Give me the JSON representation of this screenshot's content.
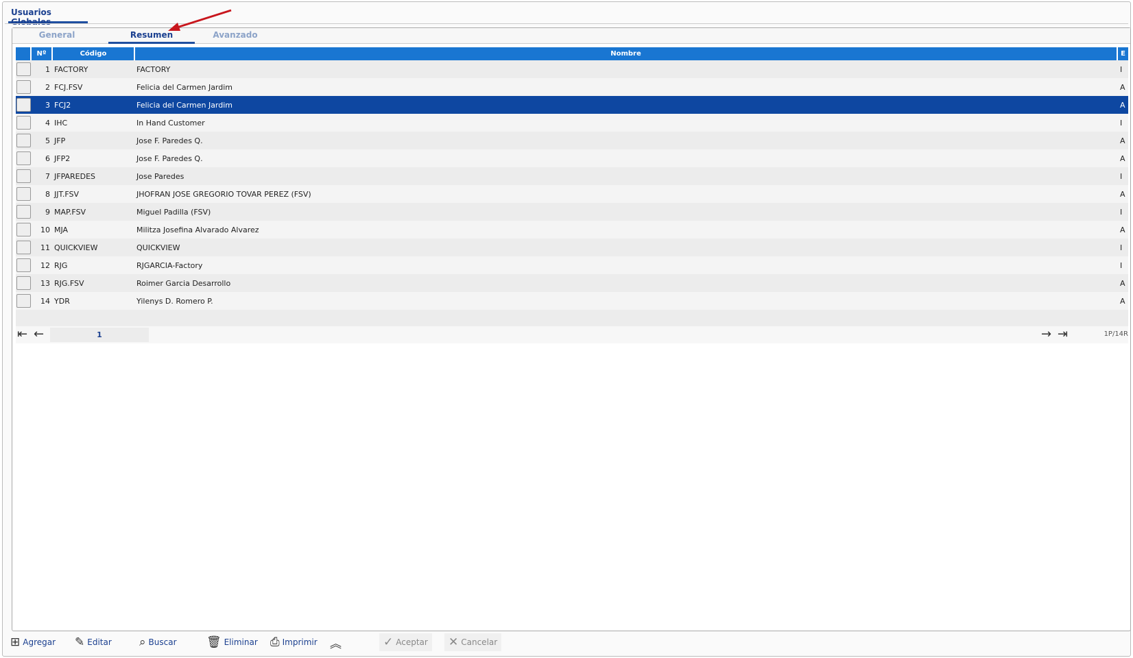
{
  "window_tab": "Usuarios Globales",
  "tabs": [
    {
      "label": "General"
    },
    {
      "label": "Resumen"
    },
    {
      "label": "Avanzado"
    }
  ],
  "columns": {
    "num": "Nº",
    "code": "Código",
    "name": "Nombre",
    "status": "E"
  },
  "rows": [
    {
      "n": "1",
      "code": "FACTORY",
      "name": "FACTORY",
      "e": "I"
    },
    {
      "n": "2",
      "code": "FCJ.FSV",
      "name": "Felicia del Carmen Jardim",
      "e": "A"
    },
    {
      "n": "3",
      "code": "FCJ2",
      "name": "Felicia del Carmen Jardim",
      "e": "A"
    },
    {
      "n": "4",
      "code": "IHC",
      "name": "In Hand Customer",
      "e": "I"
    },
    {
      "n": "5",
      "code": "JFP",
      "name": "Jose F. Paredes Q.",
      "e": "A"
    },
    {
      "n": "6",
      "code": "JFP2",
      "name": "Jose F. Paredes Q.",
      "e": "A"
    },
    {
      "n": "7",
      "code": "JFPAREDES",
      "name": "Jose Paredes",
      "e": "I"
    },
    {
      "n": "8",
      "code": "JJT.FSV",
      "name": "JHOFRAN JOSE GREGORIO TOVAR PEREZ (FSV)",
      "e": "A"
    },
    {
      "n": "9",
      "code": "MAP.FSV",
      "name": "Miguel Padilla (FSV)",
      "e": "I"
    },
    {
      "n": "10",
      "code": "MJA",
      "name": "Militza Josefina Alvarado Alvarez",
      "e": "A"
    },
    {
      "n": "11",
      "code": "QUICKVIEW",
      "name": "QUICKVIEW",
      "e": "I"
    },
    {
      "n": "12",
      "code": "RJG",
      "name": "RJGARCIA-Factory",
      "e": "I"
    },
    {
      "n": "13",
      "code": "RJG.FSV",
      "name": "Roimer Garcia Desarrollo",
      "e": "A"
    },
    {
      "n": "14",
      "code": "YDR",
      "name": "Yilenys D. Romero P.",
      "e": "A"
    }
  ],
  "pager": {
    "page": "1",
    "info": "1P/14R"
  },
  "toolbar": {
    "add": "Agregar",
    "edit": "Editar",
    "search": "Buscar",
    "delete": "Eliminar",
    "print": "Imprimir",
    "accept": "Aceptar",
    "cancel": "Cancelar"
  }
}
